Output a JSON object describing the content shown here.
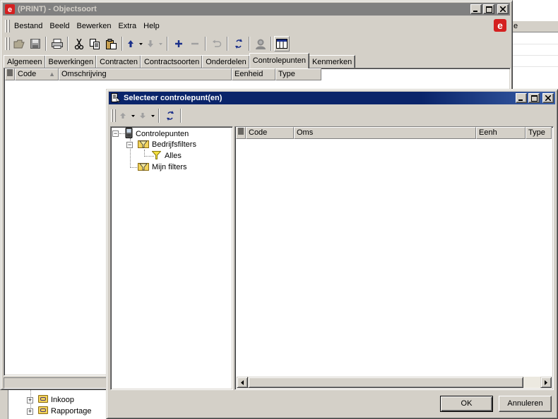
{
  "main_window": {
    "title": "(PRINT) - Objectsoort",
    "menu": [
      "Bestand",
      "Beeld",
      "Bewerken",
      "Extra",
      "Help"
    ],
    "menu_underline": [
      "B",
      "e",
      "w",
      "E",
      "H"
    ],
    "toolbar_icons": [
      "open-icon",
      "save-icon",
      "print-icon",
      "cut-icon",
      "copy-icon",
      "paste-icon",
      "move-up-icon",
      "move-down-icon",
      "add-icon",
      "remove-icon",
      "undo-icon",
      "refresh-icon",
      "user-icon",
      "layout-icon"
    ],
    "tabs": [
      "Algemeen",
      "Bewerkingen",
      "Contracten",
      "Contractsoorten",
      "Onderdelen",
      "Controlepunten",
      "Kenmerken"
    ],
    "active_tab": "Controlepunten",
    "columns": [
      "Code",
      "Omschrijving",
      "Eenheid",
      "Type"
    ],
    "sort_indicator": "▲"
  },
  "background_tree": {
    "items": [
      "Inkoop",
      "Rapportage"
    ]
  },
  "background_window": {
    "header_fragment": "e"
  },
  "dialog": {
    "title": "Selecteer controlepunt(en)",
    "tree": {
      "root": "Controlepunten",
      "group": "Bedrijfsfilters",
      "leaf": "Alles",
      "second_group": "Mijn filters"
    },
    "columns": [
      "Code",
      "Oms",
      "Eenh",
      "Type"
    ],
    "ok_label": "OK",
    "cancel_label": "Annuleren"
  },
  "colors": {
    "active_title": "#0a246a",
    "inactive_title": "#808080",
    "brand_red": "#d42020"
  }
}
